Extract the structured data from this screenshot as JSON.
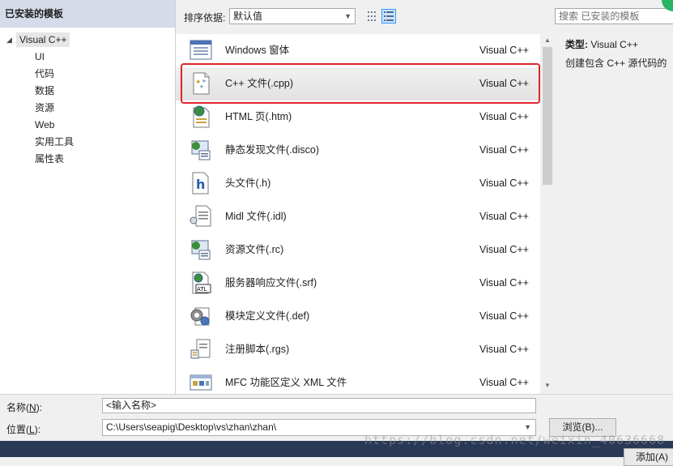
{
  "left_panel": {
    "header": "已安装的模板",
    "root": "Visual C++",
    "children": [
      "UI",
      "代码",
      "数据",
      "资源",
      "Web",
      "实用工具",
      "属性表"
    ]
  },
  "topbar": {
    "sort_label": "排序依据:",
    "sort_value": "默认值",
    "search_placeholder": "搜索 已安装的模板"
  },
  "templates": [
    {
      "name": "Windows 窗体",
      "language": "Visual C++",
      "icon": "windows-form-icon"
    },
    {
      "name": "C++ 文件(.cpp)",
      "language": "Visual C++",
      "icon": "cpp-file-icon",
      "selected": true
    },
    {
      "name": "HTML 页(.htm)",
      "language": "Visual C++",
      "icon": "html-page-icon"
    },
    {
      "name": "静态发现文件(.disco)",
      "language": "Visual C++",
      "icon": "disco-file-icon"
    },
    {
      "name": "头文件(.h)",
      "language": "Visual C++",
      "icon": "header-file-icon"
    },
    {
      "name": "Midl 文件(.idl)",
      "language": "Visual C++",
      "icon": "midl-file-icon"
    },
    {
      "name": "资源文件(.rc)",
      "language": "Visual C++",
      "icon": "resource-file-icon"
    },
    {
      "name": "服务器响应文件(.srf)",
      "language": "Visual C++",
      "icon": "srf-file-icon"
    },
    {
      "name": "模块定义文件(.def)",
      "language": "Visual C++",
      "icon": "def-file-icon"
    },
    {
      "name": "注册脚本(.rgs)",
      "language": "Visual C++",
      "icon": "rgs-file-icon"
    },
    {
      "name": "MFC 功能区定义 XML 文件",
      "language": "Visual C++",
      "icon": "ribbon-xml-icon"
    }
  ],
  "info": {
    "type_label": "类型:",
    "type_value": "Visual C++",
    "description": "创建包含 C++ 源代码的"
  },
  "form": {
    "name_label": "名称",
    "name_key": "N",
    "name_value": "<输入名称>",
    "location_label": "位置",
    "location_key": "L",
    "location_value": "C:\\Users\\seapig\\Desktop\\vs\\zhan\\zhan\\",
    "browse_label": "浏览(B)...",
    "add_label": "添加(A)"
  },
  "watermark": "https://blog.csdn.net/weixin_40636668",
  "colors": {
    "highlight": "#e0242a",
    "footer": "#293955",
    "header": "#d6dbe9"
  }
}
